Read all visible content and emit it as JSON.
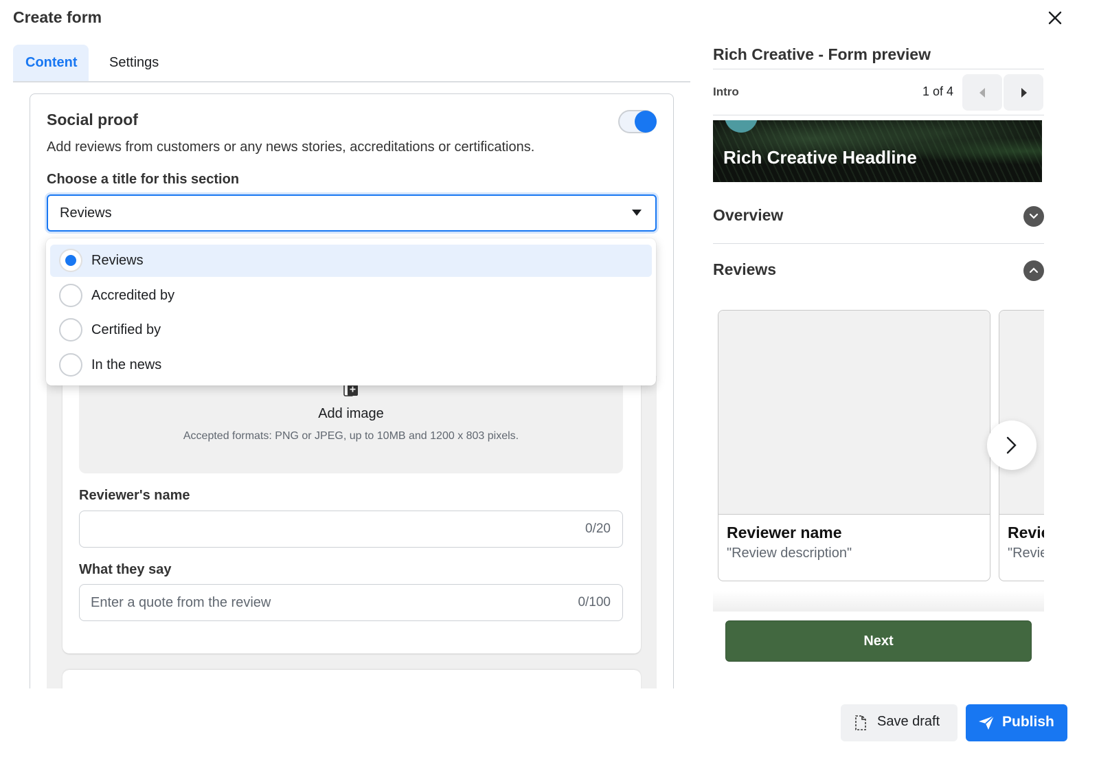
{
  "header": {
    "title": "Create form",
    "close_icon": "close-icon"
  },
  "tabs": [
    {
      "label": "Content",
      "active": true
    },
    {
      "label": "Settings",
      "active": false
    }
  ],
  "social_proof": {
    "title": "Social proof",
    "enabled": true,
    "description": "Add reviews from customers or any news stories, accreditations or certifications.",
    "choose_label": "Choose a title for this section",
    "selected_value": "Reviews",
    "options": [
      {
        "label": "Reviews",
        "selected": true
      },
      {
        "label": "Accredited by",
        "selected": false
      },
      {
        "label": "Certified by",
        "selected": false
      },
      {
        "label": "In the news",
        "selected": false
      }
    ],
    "upload": {
      "label": "Add image",
      "hint": "Accepted formats: PNG or JPEG, up to 10MB and 1200 x 803 pixels."
    },
    "reviewer_name": {
      "label": "Reviewer's name",
      "value": "",
      "placeholder": "",
      "counter": "0/20"
    },
    "what_they_say": {
      "label": "What they say",
      "value": "",
      "placeholder": "Enter a quote from the review",
      "counter": "0/100"
    }
  },
  "preview": {
    "title": "Rich Creative - Form preview",
    "section": "Intro",
    "page_indicator": "1 of 4",
    "headline": "Rich Creative Headline",
    "accordions": [
      {
        "label": "Overview",
        "expanded": false
      },
      {
        "label": "Reviews",
        "expanded": true
      }
    ],
    "review_cards": [
      {
        "name": "Reviewer name",
        "description": "\"Review description\""
      },
      {
        "name": "Reviewer name",
        "description": "\"Review description\""
      }
    ],
    "next_label": "Next",
    "button_color": "#426840"
  },
  "footer": {
    "save_draft_label": "Save draft",
    "publish_label": "Publish",
    "accent": "#1877f2"
  }
}
